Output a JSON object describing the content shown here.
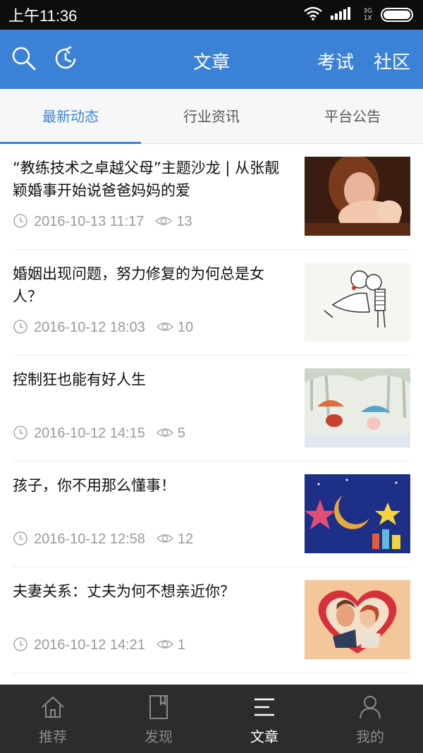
{
  "status_bar": {
    "time": "上午11:36",
    "network_top": "3G",
    "network_bottom": "1X"
  },
  "header": {
    "title": "文章",
    "exam_link": "考试",
    "community_link": "社区"
  },
  "tabs": [
    {
      "label": "最新动态",
      "active": true
    },
    {
      "label": "行业资讯",
      "active": false
    },
    {
      "label": "平台公告",
      "active": false
    }
  ],
  "articles": [
    {
      "title": "“教练技术之卓越父母”主题沙龙 | 从张靓颖婚事开始说爸爸妈妈的爱",
      "time": "2016-10-13 11:17",
      "views": "13",
      "thumb_icon": "mother-baby-photo"
    },
    {
      "title": "婚姻出现问题，努力修复的为何总是女人？",
      "time": "2016-10-12 18:03",
      "views": "10",
      "thumb_icon": "couple-kiss-sketch"
    },
    {
      "title": "控制狂也能有好人生",
      "time": "2016-10-12 14:15",
      "views": "5",
      "thumb_icon": "umbrella-rain-illustration"
    },
    {
      "title": "孩子，你不用那么懂事！",
      "time": "2016-10-12 12:58",
      "views": "12",
      "thumb_icon": "night-sky-moon-stars"
    },
    {
      "title": "夫妻关系：丈夫为何不想亲近你？",
      "time": "2016-10-12 14:21",
      "views": "1",
      "thumb_icon": "retro-couple-heart"
    }
  ],
  "bottom_nav": [
    {
      "label": "推荐",
      "icon": "home-icon",
      "active": false
    },
    {
      "label": "发现",
      "icon": "book-icon",
      "active": false
    },
    {
      "label": "文章",
      "icon": "menu-lines-icon",
      "active": true
    },
    {
      "label": "我的",
      "icon": "person-icon",
      "active": false
    }
  ],
  "colors": {
    "accent": "#3b82d6",
    "nav_bg": "#2c2c2c",
    "meta_gray": "#9a9a9a"
  }
}
